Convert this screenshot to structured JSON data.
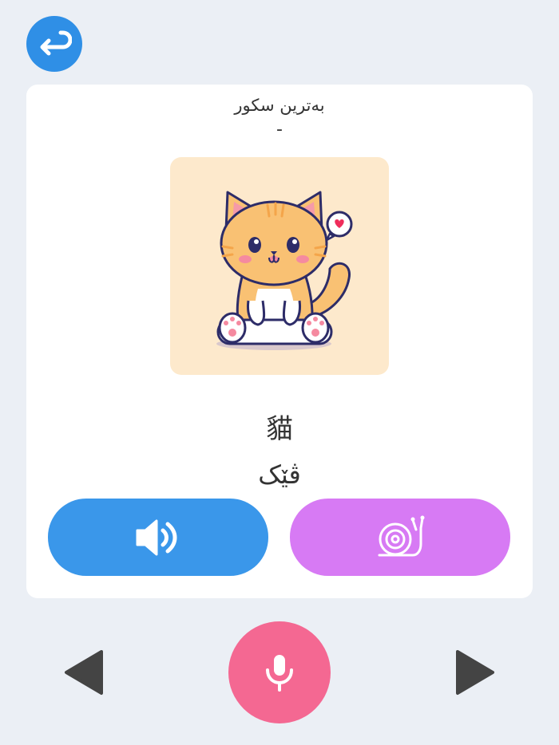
{
  "header": {
    "back_icon": "return-arrow-icon",
    "back_color": "#2f8fe6"
  },
  "card": {
    "score_label": "بەترین سکور",
    "score_value": "-",
    "picture_icon": "cute-cat-illustration",
    "word": "貓",
    "translation": "ڤێک"
  },
  "actions": {
    "speak_icon": "speaker-icon",
    "speak_color": "#3a97ea",
    "slow_icon": "snail-icon",
    "slow_color": "#d77af4"
  },
  "footer": {
    "prev_icon": "triangle-left-icon",
    "mic_icon": "microphone-icon",
    "mic_color": "#f46892",
    "next_icon": "triangle-right-icon"
  }
}
